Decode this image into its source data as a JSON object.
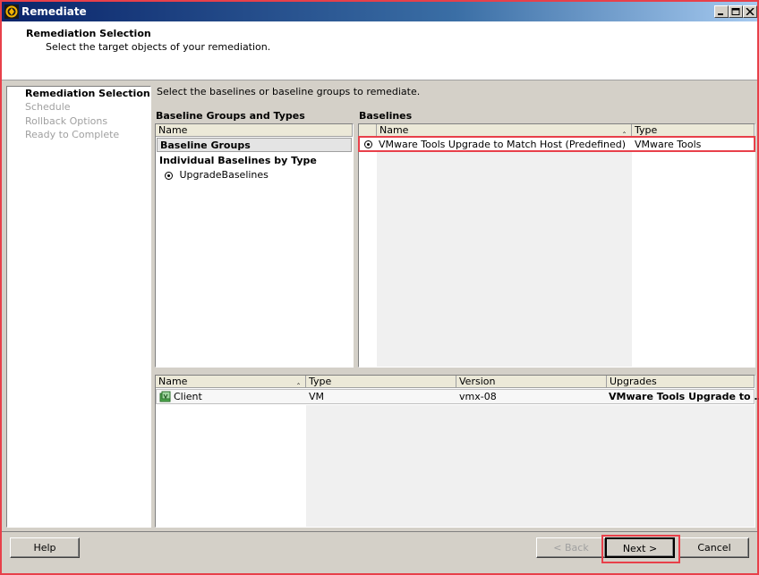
{
  "window": {
    "title": "Remediate"
  },
  "header": {
    "title": "Remediation Selection",
    "subtitle": "Select the target objects of your remediation."
  },
  "nav": {
    "items": [
      {
        "label": "Remediation Selection",
        "active": true
      },
      {
        "label": "Schedule",
        "active": false
      },
      {
        "label": "Rollback Options",
        "active": false
      },
      {
        "label": "Ready to Complete",
        "active": false
      }
    ]
  },
  "main": {
    "instruction": "Select the baselines or baseline groups to remediate.",
    "groups_panel": {
      "title": "Baseline Groups and Types",
      "column": "Name",
      "group_header": "Baseline Groups",
      "individual_header": "Individual Baselines by Type",
      "individual_item": "UpgradeBaselines"
    },
    "baselines_panel": {
      "title": "Baselines",
      "columns": [
        "Name",
        "Type"
      ],
      "rows": [
        {
          "name": "VMware Tools Upgrade to Match Host (Predefined)",
          "type": "VMware Tools"
        }
      ]
    },
    "targets_table": {
      "columns": [
        "Name",
        "Type",
        "Version",
        "Upgrades"
      ],
      "rows": [
        {
          "name": "Client",
          "type": "VM",
          "version": "vmx-08",
          "upgrades": "VMware Tools Upgrade to ..."
        }
      ]
    }
  },
  "footer": {
    "help": "Help",
    "back": "< Back",
    "next": "Next >",
    "cancel": "Cancel"
  },
  "colors": {
    "highlight": "#e8404a",
    "titlebar": "#0a246a"
  }
}
